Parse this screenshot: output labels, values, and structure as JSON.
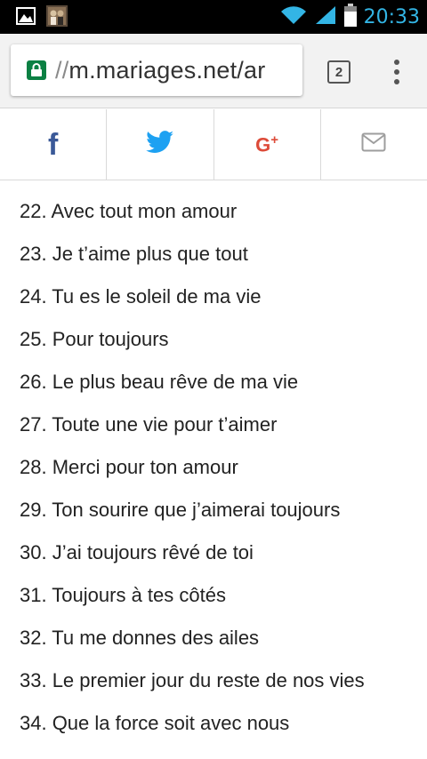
{
  "status_bar": {
    "time": "20:33",
    "icons": [
      "image-notification-icon",
      "photo-thumbnail-icon",
      "wifi-icon",
      "signal-icon",
      "battery-icon"
    ],
    "clock_color": "#33b5e5"
  },
  "browser": {
    "url_scheme": "//",
    "url_host": "m.mariages.net/ar",
    "tab_count": "2",
    "lock_color": "#0b8043"
  },
  "share": {
    "buttons": [
      {
        "name": "facebook",
        "icon": "facebook-icon",
        "color": "#3b5998"
      },
      {
        "name": "twitter",
        "icon": "twitter-icon",
        "color": "#1da1f2"
      },
      {
        "name": "google-plus",
        "icon": "google-plus-icon",
        "color": "#dd4b39",
        "glyph": "G+"
      },
      {
        "name": "email",
        "icon": "mail-icon",
        "color": "#9e9e9e"
      }
    ]
  },
  "list": {
    "items": [
      "22. Avec tout mon amour",
      "23. Je t’aime plus que tout",
      "24. Tu es le soleil de ma vie",
      "25. Pour toujours",
      "26. Le plus beau rêve de ma vie",
      "27. Toute une vie pour t’aimer",
      "28. Merci pour ton amour",
      "29. Ton sourire que j’aimerai toujours",
      "30. J’ai toujours rêvé de toi",
      "31. Toujours à tes côtés",
      "32. Tu me donnes des ailes",
      "33. Le premier jour du reste de nos vies",
      "34. Que la force soit avec nous"
    ]
  }
}
